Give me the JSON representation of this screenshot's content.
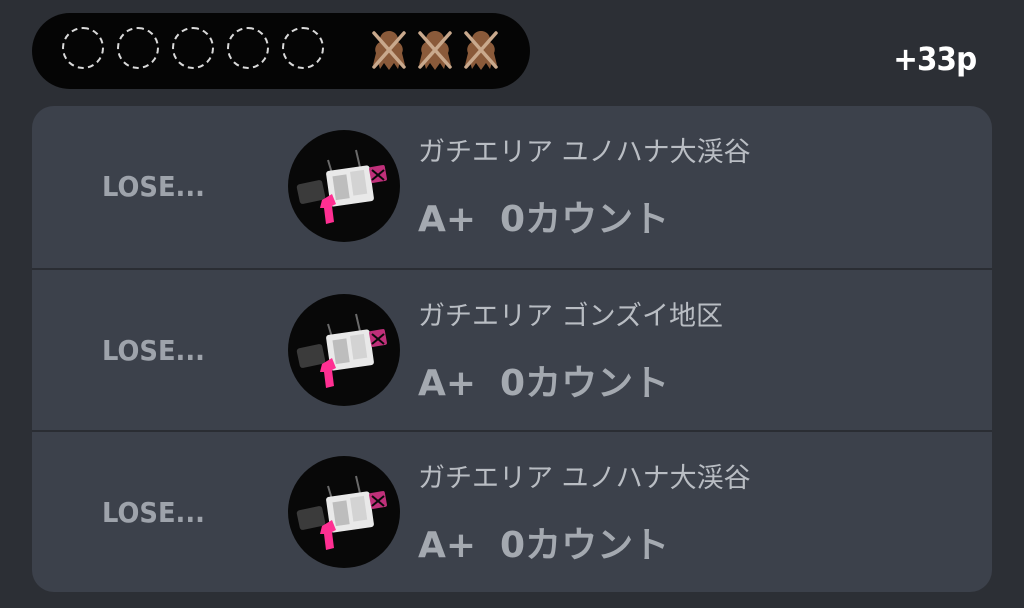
{
  "header": {
    "win_slots": 5,
    "loss_marks": 3,
    "points": "+33p",
    "colors": {
      "slot": "#d9d9d9",
      "loss_mark": "#8a5a3a"
    },
    "icons": {
      "win_slot": "empty-win-slot-icon",
      "loss": "crossed-splat-icon"
    }
  },
  "matches": [
    {
      "result": "LOSE...",
      "stage": "ガチエリア ユノハナ大渓谷",
      "rank": "A+",
      "count": "0カウント",
      "icon": "splat-zones-mode-icon"
    },
    {
      "result": "LOSE...",
      "stage": "ガチエリア ゴンズイ地区",
      "rank": "A+",
      "count": "0カウント",
      "icon": "splat-zones-mode-icon"
    },
    {
      "result": "LOSE...",
      "stage": "ガチエリア ユノハナ大渓谷",
      "rank": "A+",
      "count": "0カウント",
      "icon": "splat-zones-mode-icon"
    }
  ]
}
